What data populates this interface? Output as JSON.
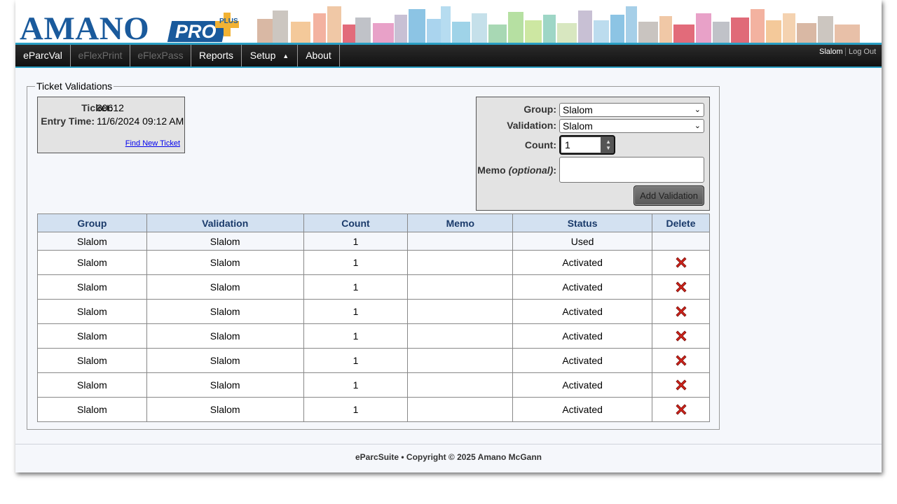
{
  "header": {
    "logo_amano": "AMANO",
    "logo_pro": "PRO",
    "logo_plus": "PLUS"
  },
  "nav": {
    "items": [
      {
        "label": "eParcVal",
        "enabled": true
      },
      {
        "label": "eFlexPrint",
        "enabled": false
      },
      {
        "label": "eFlexPass",
        "enabled": false
      },
      {
        "label": "Reports",
        "enabled": true
      },
      {
        "label": "Setup",
        "enabled": true,
        "icon": "caret-up-icon"
      },
      {
        "label": "About",
        "enabled": true
      }
    ],
    "caret": "▲",
    "user": "Slalom",
    "logout": "Log Out"
  },
  "fieldset": {
    "legend": "Ticket Validations"
  },
  "ticket": {
    "ticket_label": "Ticket:",
    "ticket_value": "30612",
    "entry_label": "Entry Time:",
    "entry_value": "11/6/2024 09:12 AM",
    "find_link": "Find New Ticket"
  },
  "form": {
    "group_label": "Group:",
    "group_value": "Slalom",
    "validation_label": "Validation:",
    "validation_value": "Slalom",
    "count_label": "Count:",
    "count_value": "1",
    "memo_label": "Memo",
    "memo_optional": "(optional)",
    "memo_colon": ":",
    "memo_value": "",
    "add_button": "Add Validation"
  },
  "table": {
    "headers": [
      "Group",
      "Validation",
      "Count",
      "Memo",
      "Status",
      "Delete"
    ],
    "rows": [
      {
        "group": "Slalom",
        "validation": "Slalom",
        "count": "1",
        "memo": "",
        "status": "Used",
        "deletable": false
      },
      {
        "group": "Slalom",
        "validation": "Slalom",
        "count": "1",
        "memo": "",
        "status": "Activated",
        "deletable": true
      },
      {
        "group": "Slalom",
        "validation": "Slalom",
        "count": "1",
        "memo": "",
        "status": "Activated",
        "deletable": true
      },
      {
        "group": "Slalom",
        "validation": "Slalom",
        "count": "1",
        "memo": "",
        "status": "Activated",
        "deletable": true
      },
      {
        "group": "Slalom",
        "validation": "Slalom",
        "count": "1",
        "memo": "",
        "status": "Activated",
        "deletable": true
      },
      {
        "group": "Slalom",
        "validation": "Slalom",
        "count": "1",
        "memo": "",
        "status": "Activated",
        "deletable": true
      },
      {
        "group": "Slalom",
        "validation": "Slalom",
        "count": "1",
        "memo": "",
        "status": "Activated",
        "deletable": true
      },
      {
        "group": "Slalom",
        "validation": "Slalom",
        "count": "1",
        "memo": "",
        "status": "Activated",
        "deletable": true
      }
    ],
    "delete_icon": "delete-x-icon"
  },
  "footer": {
    "text": "eParcSuite • Copyright © 2025 Amano McGann"
  },
  "colors": {
    "brand_blue": "#1a5a9c",
    "brand_gold": "#f2b233",
    "nav_accent": "#2a9fc4",
    "table_header_bg": "#d3e1f1",
    "delete_red": "#d0231b"
  }
}
